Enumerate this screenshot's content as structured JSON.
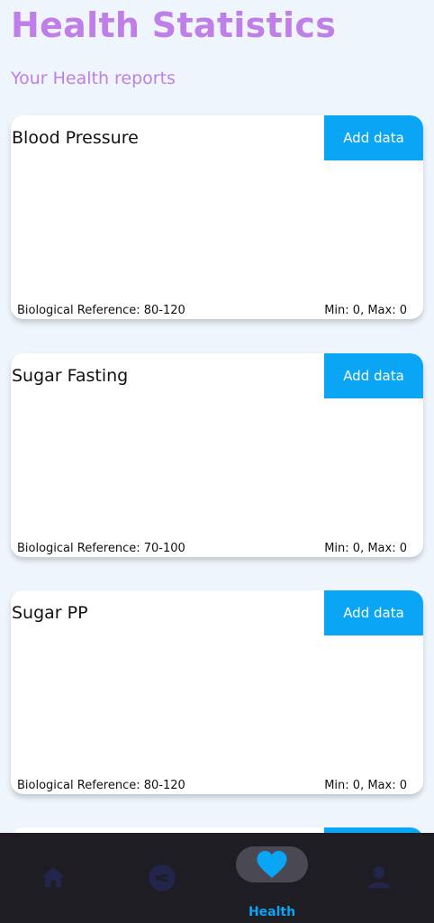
{
  "header": {
    "title": "Health Statistics",
    "subtitle": "Your Health reports"
  },
  "cards": [
    {
      "title": "Blood Pressure",
      "button_label": "Add data",
      "reference": "Biological Reference: 80-120",
      "minmax": "Min: 0, Max: 0"
    },
    {
      "title": "Sugar Fasting",
      "button_label": "Add data",
      "reference": "Biological Reference: 70-100",
      "minmax": "Min: 0, Max: 0"
    },
    {
      "title": "Sugar PP",
      "button_label": "Add data",
      "reference": "Biological Reference: 80-120",
      "minmax": "Min: 0, Max: 0"
    }
  ],
  "bottom_nav": {
    "items": [
      {
        "icon": "home-icon",
        "active": false
      },
      {
        "icon": "explore-icon",
        "active": false
      },
      {
        "icon": "heart-icon",
        "label": "Health",
        "active": true
      },
      {
        "icon": "profile-icon",
        "active": false
      }
    ]
  },
  "colors": {
    "accent": "#c07ee8",
    "button": "#0ba5f5",
    "background": "#eef5fd",
    "nav_background": "#1e1d24"
  }
}
